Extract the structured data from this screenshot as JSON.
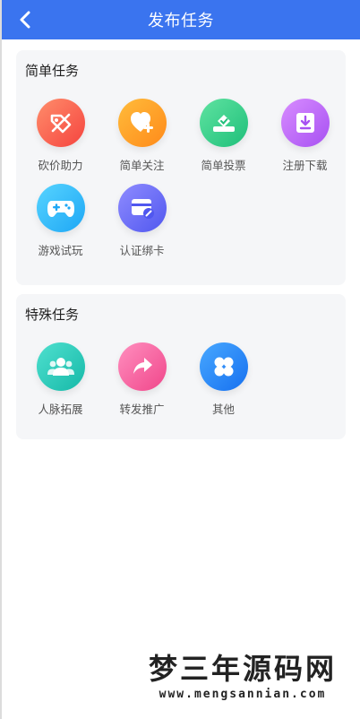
{
  "header": {
    "title": "发布任务"
  },
  "sections": [
    {
      "title": "简单任务",
      "items": [
        {
          "label": "砍价助力",
          "icon": "tag-off-icon",
          "gradient": [
            "#ff8d6b",
            "#f5443f"
          ]
        },
        {
          "label": "简单关注",
          "icon": "heart-plus-icon",
          "gradient": [
            "#ffbc3b",
            "#ff8a1a"
          ]
        },
        {
          "label": "简单投票",
          "icon": "ballot-check-icon",
          "gradient": [
            "#5fe3a1",
            "#1fbf7a"
          ]
        },
        {
          "label": "注册下载",
          "icon": "download-box-icon",
          "gradient": [
            "#d88cff",
            "#a751f2"
          ]
        },
        {
          "label": "游戏试玩",
          "icon": "gamepad-icon",
          "gradient": [
            "#57d4ff",
            "#1ea7f5"
          ]
        },
        {
          "label": "认证绑卡",
          "icon": "card-link-icon",
          "gradient": [
            "#8f8cff",
            "#5057ef"
          ]
        }
      ]
    },
    {
      "title": "特殊任务",
      "items": [
        {
          "label": "人脉拓展",
          "icon": "people-icon",
          "gradient": [
            "#4fe0cf",
            "#16b9a8"
          ]
        },
        {
          "label": "转发推广",
          "icon": "share-icon",
          "gradient": [
            "#ff8fbf",
            "#f0468a"
          ]
        },
        {
          "label": "其他",
          "icon": "clover-icon",
          "gradient": [
            "#48a8ff",
            "#1670f0"
          ]
        }
      ]
    }
  ],
  "watermark": {
    "line1": "梦三年源码网",
    "line2": "www.mengsannian.com"
  },
  "colors": {
    "header": "#3a74ef",
    "card": "#f5f6f8"
  }
}
